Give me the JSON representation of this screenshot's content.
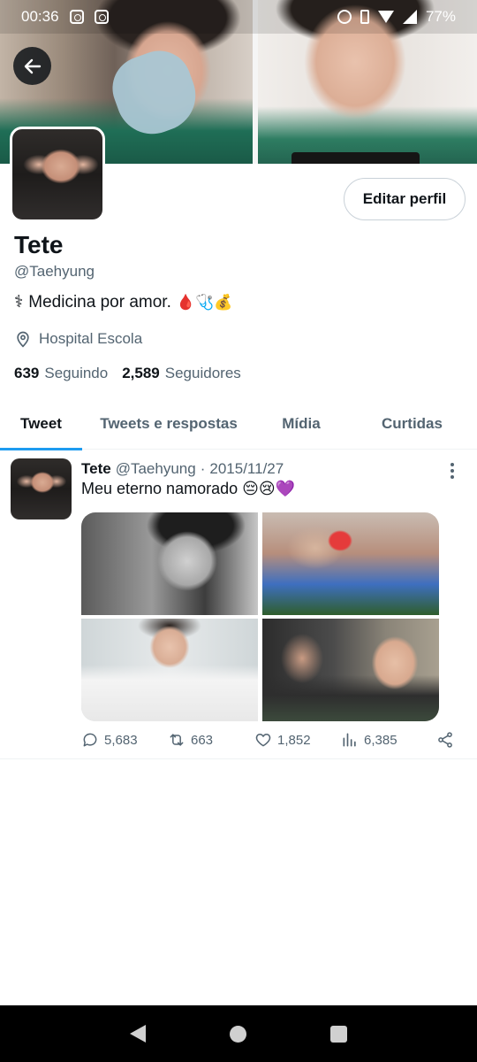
{
  "status_bar": {
    "time": "00:36",
    "battery": "77%"
  },
  "profile": {
    "display_name": "Tete",
    "handle": "@Taehyung",
    "bio_text": "Medicina por amor.",
    "bio_prefix": "⚕",
    "bio_emojis": "🩸🩺💰",
    "location": "Hospital Escola",
    "following_count": "639",
    "following_label": "Seguindo",
    "followers_count": "2,589",
    "followers_label": "Seguidores",
    "edit_button": "Editar perfil"
  },
  "tabs": [
    {
      "label": "Tweet",
      "active": true
    },
    {
      "label": "Tweets e respostas",
      "active": false
    },
    {
      "label": "Mídia",
      "active": false
    },
    {
      "label": "Curtidas",
      "active": false
    }
  ],
  "tweet": {
    "name": "Tete",
    "handle": "@Taehyung",
    "separator": "·",
    "date": "2015/11/27",
    "text": "Meu eterno namorado 😔😢💜",
    "replies": "5,683",
    "retweets": "663",
    "likes": "1,852",
    "views": "6,385"
  },
  "colors": {
    "accent": "#1d9bf0",
    "text_primary": "#0f1419",
    "text_secondary": "#536471"
  },
  "icons": {
    "back": "arrow-left-icon",
    "location": "map-pin-icon",
    "more": "more-vertical-icon",
    "reply": "reply-icon",
    "retweet": "retweet-icon",
    "like": "heart-icon",
    "views": "bar-chart-icon",
    "share": "share-icon"
  }
}
